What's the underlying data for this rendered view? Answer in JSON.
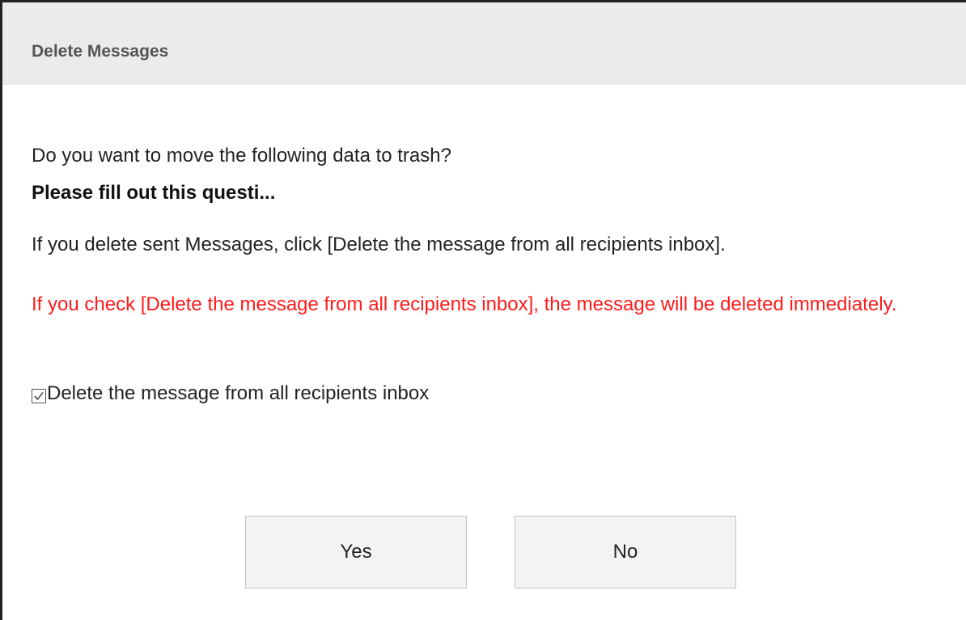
{
  "dialog": {
    "title": "Delete Messages",
    "question": "Do you want to move the following data to trash?",
    "item_name": "Please fill out this questi...",
    "info": "If you delete sent Messages, click [Delete the message from all recipients inbox].",
    "warning": "If you check [Delete the message from all recipients inbox], the message will be deleted immediately.",
    "warning_color": "#ff1a1a",
    "checkbox": {
      "label": "Delete the message from all recipients inbox",
      "checked": true
    },
    "buttons": {
      "yes_label": "Yes",
      "no_label": "No"
    }
  }
}
